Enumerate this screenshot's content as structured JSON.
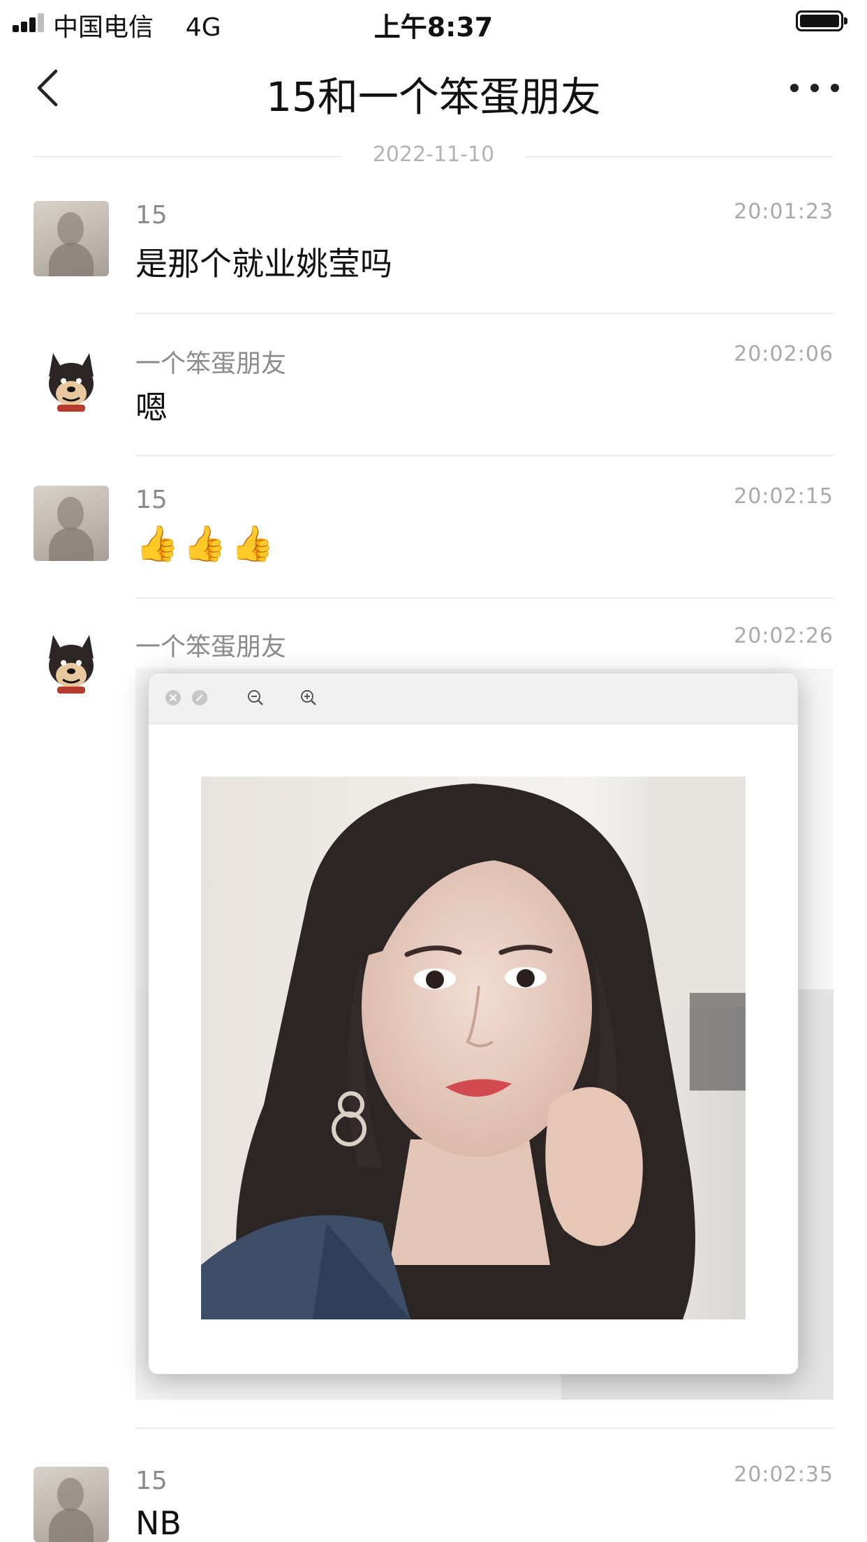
{
  "status_bar": {
    "carrier": "中国电信",
    "network": "4G",
    "time": "上午8:37"
  },
  "nav": {
    "title": "15和一个笨蛋朋友"
  },
  "date_separator": "2022-11-10",
  "messages": [
    {
      "sender": "15",
      "time": "20:01:23",
      "text": "是那个就业姚莹吗",
      "avatar": "person-avatar"
    },
    {
      "sender": "一个笨蛋朋友",
      "time": "20:02:06",
      "text": "嗯",
      "avatar": "dog-avatar"
    },
    {
      "sender": "15",
      "time": "20:02:15",
      "text": "",
      "emoji": [
        "👍",
        "👍",
        "👍"
      ],
      "avatar": "person-avatar"
    },
    {
      "sender": "一个笨蛋朋友",
      "time": "20:02:26",
      "type": "image",
      "avatar": "dog-avatar"
    },
    {
      "sender": "15",
      "time": "20:02:35",
      "text": "NB",
      "avatar": "person-avatar"
    }
  ],
  "image_viewer": {
    "buttons": [
      "close-icon",
      "minimize-icon",
      "zoom-out-icon",
      "zoom-in-icon"
    ],
    "content": "portrait-photo"
  }
}
